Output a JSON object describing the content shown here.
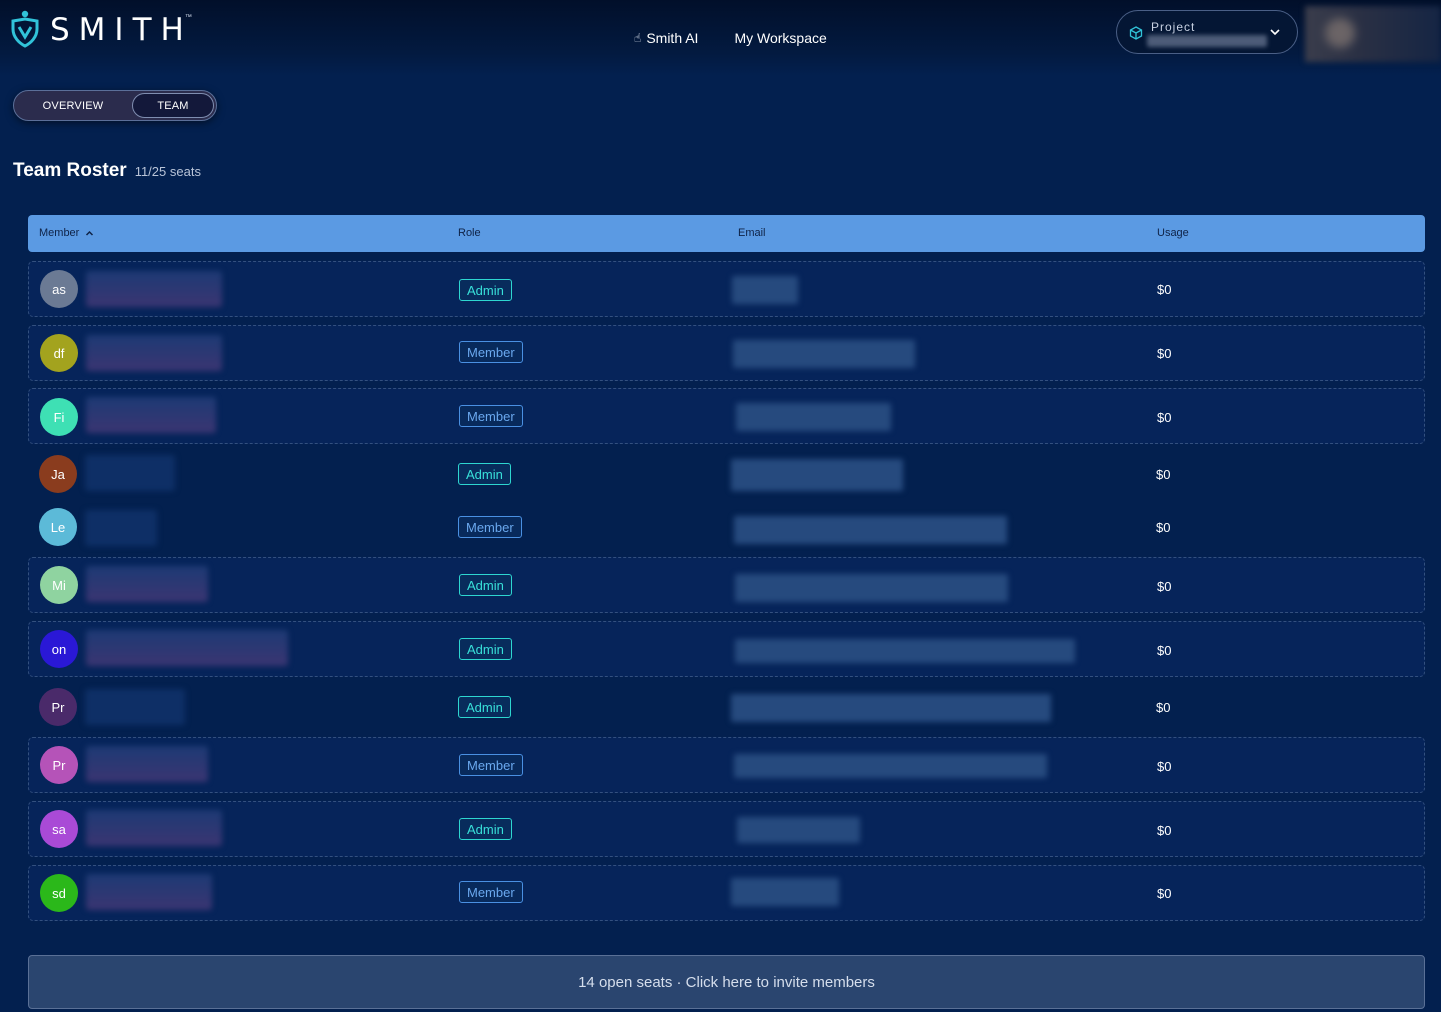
{
  "header": {
    "logo_text": "SMITH",
    "logo_tm": "™",
    "nav": [
      {
        "label": "Smith AI",
        "icon": "hand-pointer-icon"
      },
      {
        "label": "My Workspace"
      }
    ],
    "project_label": "Project"
  },
  "tabs": [
    {
      "label": "OVERVIEW",
      "active": false
    },
    {
      "label": "TEAM",
      "active": true
    }
  ],
  "page": {
    "title": "Team Roster",
    "seats": "11/25 seats"
  },
  "table": {
    "columns": [
      "Member",
      "Role",
      "Email",
      "Usage"
    ],
    "sort_column": "Member",
    "sort_direction": "ascending",
    "rows": [
      {
        "initials": "as",
        "avatar_color": "#6b7a94",
        "role": "Admin",
        "usage": "$0"
      },
      {
        "initials": "df",
        "avatar_color": "#a3a31e",
        "role": "Member",
        "usage": "$0"
      },
      {
        "initials": "Fi",
        "avatar_color": "#3ee0b4",
        "role": "Member",
        "usage": "$0"
      },
      {
        "initials": "Ja",
        "avatar_color": "#8a3c1e",
        "role": "Admin",
        "usage": "$0"
      },
      {
        "initials": "Le",
        "avatar_color": "#5cbad8",
        "role": "Member",
        "usage": "$0"
      },
      {
        "initials": "Mi",
        "avatar_color": "#8fd3a0",
        "role": "Admin",
        "usage": "$0"
      },
      {
        "initials": "on",
        "avatar_color": "#2a18d6",
        "role": "Admin",
        "usage": "$0"
      },
      {
        "initials": "Pr",
        "avatar_color": "#4a2a6a",
        "role": "Admin",
        "usage": "$0"
      },
      {
        "initials": "Pr",
        "avatar_color": "#b553b8",
        "role": "Member",
        "usage": "$0"
      },
      {
        "initials": "sa",
        "avatar_color": "#a94ad6",
        "role": "Admin",
        "usage": "$0"
      },
      {
        "initials": "sd",
        "avatar_color": "#2bb81a",
        "role": "Member",
        "usage": "$0"
      }
    ]
  },
  "invite": {
    "label": "14 open seats · Click here to invite members"
  },
  "colors": {
    "background": "#03204f",
    "table_header": "#5b9ae3",
    "admin_accent": "#2ed6d0",
    "member_accent": "#4a90e2"
  }
}
